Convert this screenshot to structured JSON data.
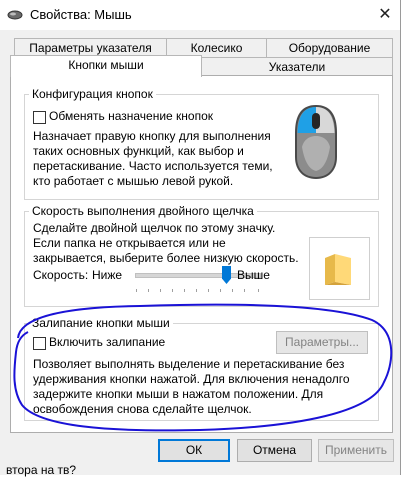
{
  "window": {
    "title": "Свойства: Мышь",
    "close_glyph": "✕"
  },
  "tabs": {
    "row1": [
      "Параметры указателя",
      "Колесико",
      "Оборудование"
    ],
    "row2": [
      "Кнопки мыши",
      "Указатели"
    ],
    "active": "Кнопки мыши"
  },
  "button_config": {
    "title": "Конфигурация кнопок",
    "swap_label": "Обменять назначение кнопок",
    "description": [
      "Назначает правую кнопку для выполнения",
      "таких основных функций, как выбор и",
      "перетаскивание. Часто используется теми,",
      "кто работает с мышью левой рукой."
    ]
  },
  "double_click": {
    "title": "Скорость выполнения двойного щелчка",
    "description": [
      "Сделайте двойной щелчок по этому значку.",
      "Если папка не открывается или не",
      "закрывается, выберите более низкую скорость."
    ],
    "speed_label": "Скорость:",
    "slow_label": "Ниже",
    "fast_label": "Выше"
  },
  "click_lock": {
    "title": "Залипание кнопки мыши",
    "enable_label": "Включить залипание",
    "params_button": "Параметры...",
    "description": [
      "Позволяет выполнять выделение и перетаскивание без",
      "удерживания кнопки нажатой. Для включения ненадолго",
      "задержите кнопки мыши в нажатом положении. Для",
      "освобождения снова сделайте щелчок."
    ]
  },
  "footer": {
    "ok": "ОК",
    "cancel": "Отмена",
    "apply": "Применить"
  },
  "background_text": "втора на тв?",
  "colors": {
    "accent": "#0078d7",
    "annotation": "#1a12d6"
  }
}
